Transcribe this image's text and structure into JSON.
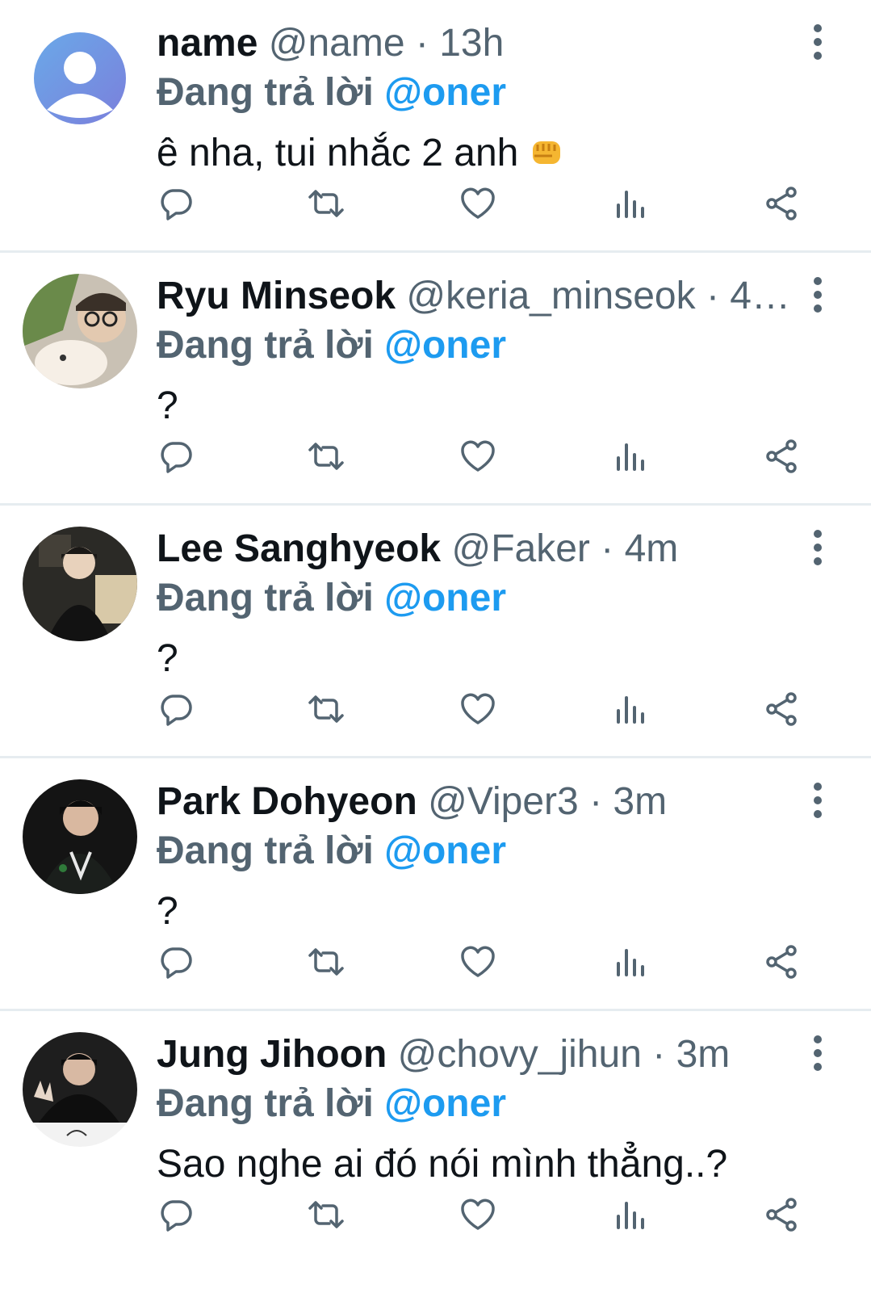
{
  "replying_prefix": "Đang trả lời",
  "colors": {
    "accent": "#1d9bf0",
    "secondary_text": "#536471",
    "divider": "#e6ecf0"
  },
  "icons": [
    "reply-icon",
    "retweet-icon",
    "like-icon",
    "analytics-icon",
    "share-icon",
    "more-options-icon"
  ],
  "tweets": [
    {
      "name": "name",
      "handle": "@name",
      "sep": "·",
      "time": "13h",
      "mention": "@oner",
      "text": "ê nha, tui nhắc 2 anh",
      "emoji": "oncoming-fist"
    },
    {
      "name": "Ryu Minseok",
      "handle": "@keria_minseok",
      "sep": "·",
      "time": "4…",
      "mention": "@oner",
      "text": "?"
    },
    {
      "name": "Lee Sanghyeok",
      "handle": "@Faker",
      "sep": "·",
      "time": "4m",
      "mention": "@oner",
      "text": "?"
    },
    {
      "name": "Park Dohyeon",
      "handle": "@Viper3",
      "sep": "·",
      "time": "3m",
      "mention": "@oner",
      "text": "?"
    },
    {
      "name": "Jung Jihoon",
      "handle": "@chovy_jihun",
      "sep": "·",
      "time": "3m",
      "mention": "@oner",
      "text": "Sao nghe ai đó nói mình thẳng..?"
    }
  ]
}
